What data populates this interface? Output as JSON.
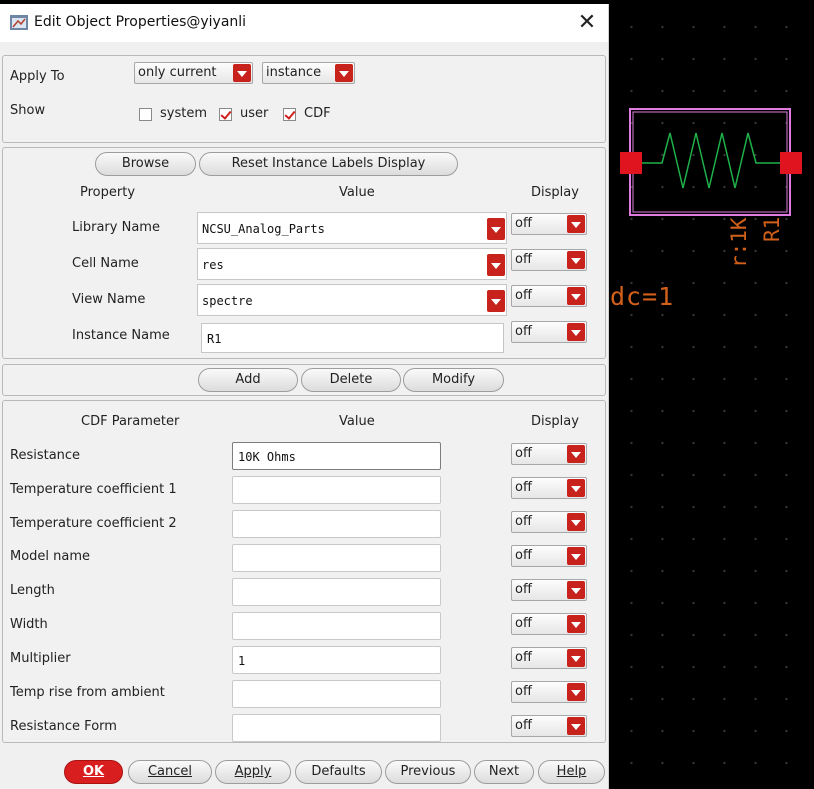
{
  "window": {
    "title": "Edit Object Properties@yiyanli",
    "close_glyph": "✕"
  },
  "apply_to": {
    "label": "Apply To",
    "scope": "only current",
    "target": "instance"
  },
  "show": {
    "label": "Show",
    "options": [
      {
        "label": "system",
        "checked": false
      },
      {
        "label": "user",
        "checked": true
      },
      {
        "label": "CDF",
        "checked": true
      }
    ]
  },
  "instance_panel": {
    "browse_label": "Browse",
    "reset_label": "Reset Instance Labels Display",
    "headers": {
      "property": "Property",
      "value": "Value",
      "display": "Display"
    },
    "rows": [
      {
        "name": "Library Name",
        "value": "NCSU_Analog_Parts",
        "display": "off"
      },
      {
        "name": "Cell Name",
        "value": "res",
        "display": "off"
      },
      {
        "name": "View Name",
        "value": "spectre",
        "display": "off"
      },
      {
        "name": "Instance Name",
        "value": "R1",
        "display": "off"
      }
    ]
  },
  "user_panel": {
    "add_label": "Add",
    "delete_label": "Delete",
    "modify_label": "Modify"
  },
  "cdf_panel": {
    "headers": {
      "parameter": "CDF Parameter",
      "value": "Value",
      "display": "Display"
    },
    "rows": [
      {
        "name": "Resistance",
        "value": "10K Ohms",
        "display": "off"
      },
      {
        "name": "Temperature coefficient 1",
        "value": "",
        "display": "off"
      },
      {
        "name": "Temperature coefficient 2",
        "value": "",
        "display": "off"
      },
      {
        "name": "Model name",
        "value": "",
        "display": "off"
      },
      {
        "name": "Length",
        "value": "",
        "display": "off"
      },
      {
        "name": "Width",
        "value": "",
        "display": "off"
      },
      {
        "name": "Multiplier",
        "value": "1",
        "display": "off"
      },
      {
        "name": "Temp rise from ambient",
        "value": "",
        "display": "off"
      },
      {
        "name": "Resistance Form",
        "value": "",
        "display": "off"
      }
    ]
  },
  "footer": {
    "ok": "OK",
    "cancel": "Cancel",
    "apply": "Apply",
    "defaults": "Defaults",
    "previous": "Previous",
    "next": "Next",
    "help": "Help"
  },
  "canvas": {
    "param_label": "dc=1",
    "value_label": "r:1K",
    "inst_label": "R1",
    "colors": {
      "wire": "#1fb24a",
      "pin": "#e0141e",
      "box": "#e07be0",
      "label": "#d2601a"
    }
  }
}
